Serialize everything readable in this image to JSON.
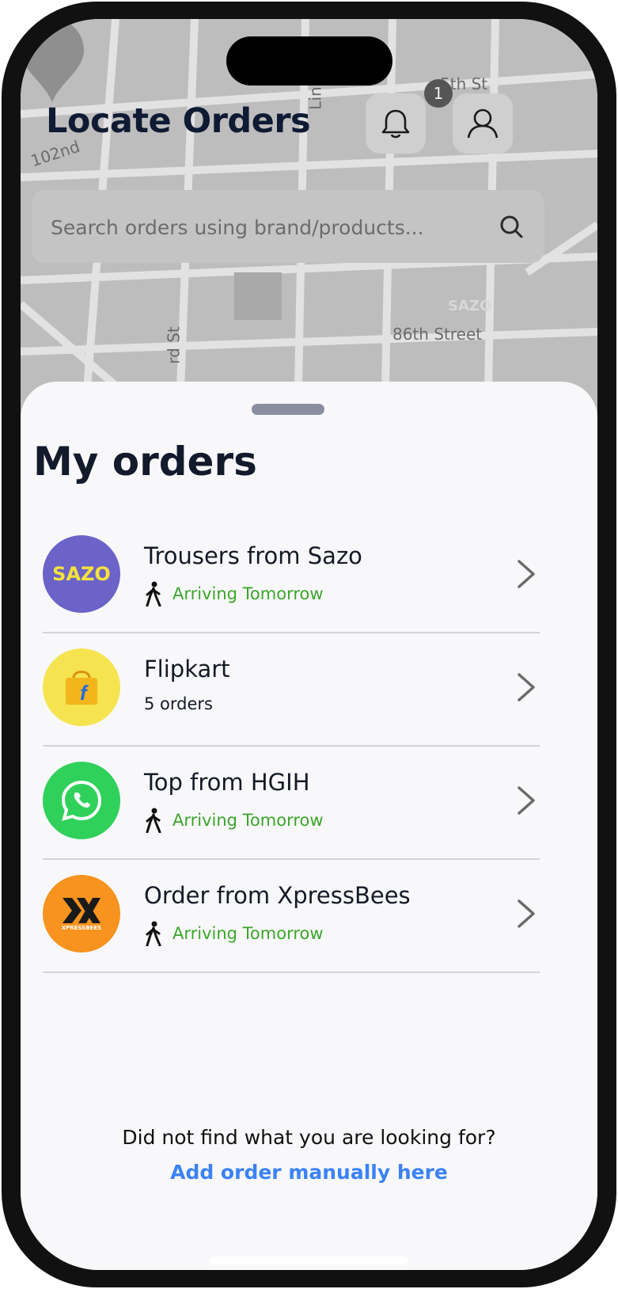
{
  "header": {
    "title": "Locate Orders",
    "notification_count": "1"
  },
  "search": {
    "placeholder": "Search orders using brand/products..."
  },
  "map": {
    "pin_label": "SAZO",
    "streets": [
      "102nd",
      "Lin",
      "5th St",
      "rd St",
      "86th Street"
    ]
  },
  "sheet": {
    "title": "My orders",
    "orders": [
      {
        "name": "Trousers from Sazo",
        "sub": "Arriving Tomorrow",
        "logo_text": "SAZO",
        "logo_color": "#6b63c8"
      },
      {
        "name": "Flipkart",
        "sub": "5 orders",
        "logo_color": "#f5e44f"
      },
      {
        "name": "Top from HGIH",
        "sub": "Arriving Tomorrow",
        "logo_color": "#2fd15a"
      },
      {
        "name": "Order from XpressBees",
        "sub": "Arriving Tomorrow",
        "logo_text": "XPRESSBEES",
        "logo_color": "#f7931e"
      }
    ],
    "footer_question": "Did not find what you are looking for?",
    "footer_link": "Add order manually here"
  },
  "colors": {
    "status_green": "#3aa62a",
    "link_blue": "#3b82f6"
  }
}
